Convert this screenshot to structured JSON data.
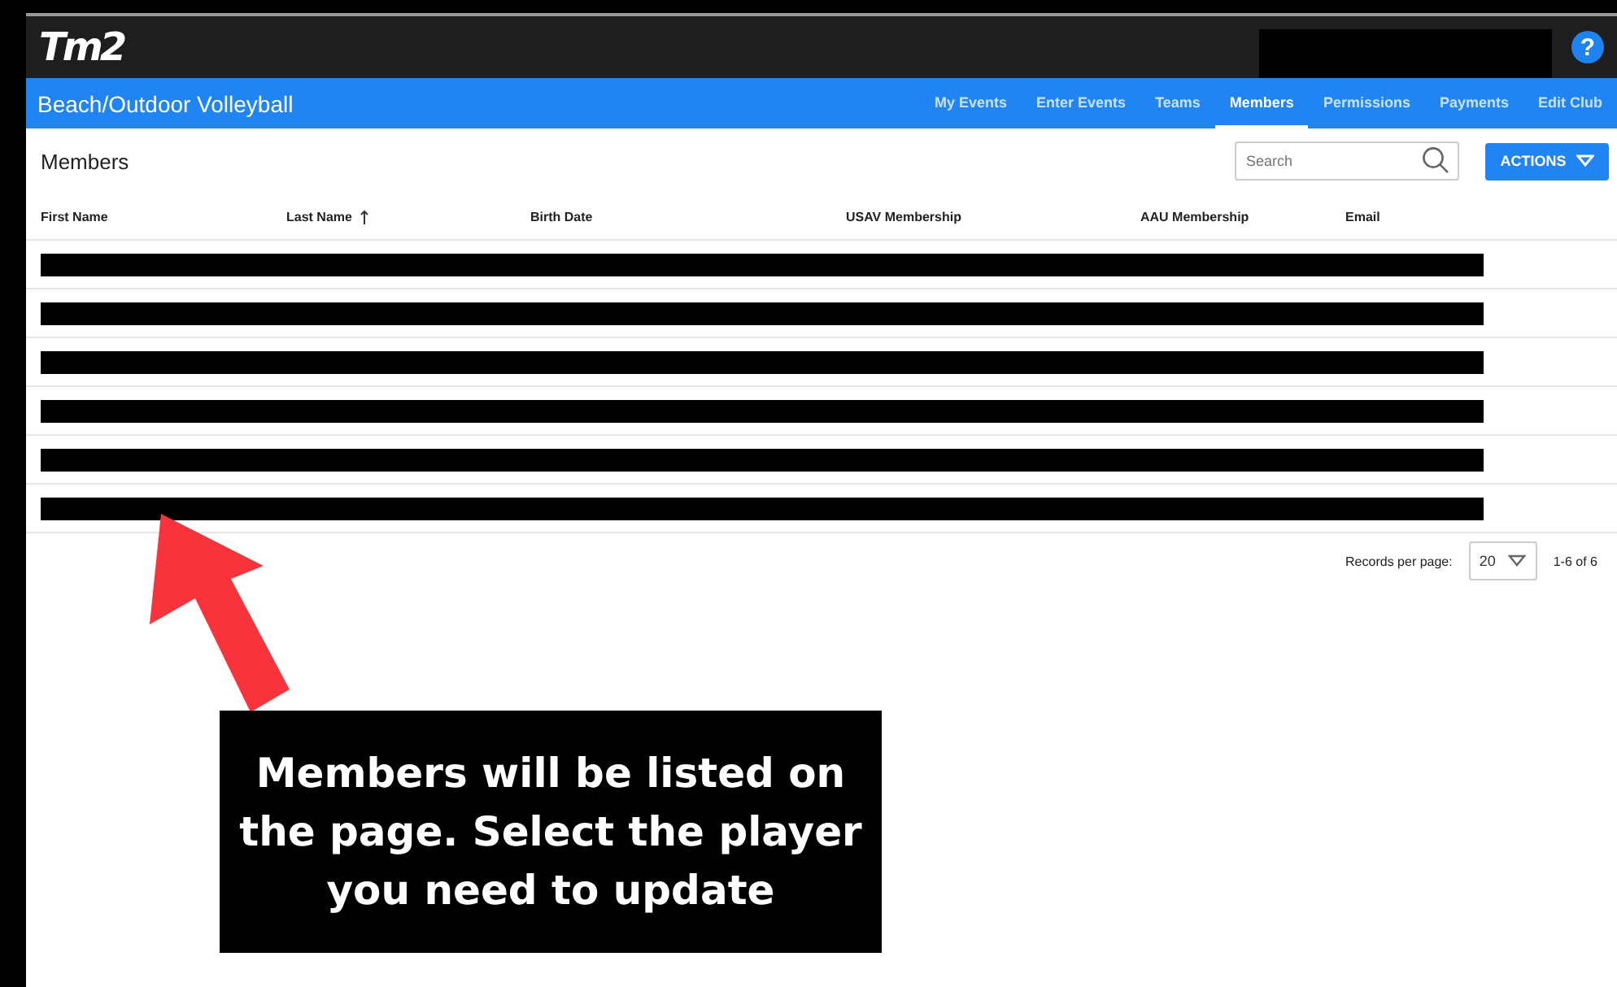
{
  "header": {
    "logo": "Tm2",
    "help": "?"
  },
  "nav": {
    "title": "Beach/Outdoor Volleyball",
    "tabs": [
      {
        "label": "My Events",
        "selected": false
      },
      {
        "label": "Enter Events",
        "selected": false
      },
      {
        "label": "Teams",
        "selected": false
      },
      {
        "label": "Members",
        "selected": true
      },
      {
        "label": "Permissions",
        "selected": false
      },
      {
        "label": "Payments",
        "selected": false
      },
      {
        "label": "Edit Club",
        "selected": false
      }
    ]
  },
  "page": {
    "title": "Members",
    "search": {
      "placeholder": "Search"
    },
    "actions": "ACTIONS"
  },
  "table": {
    "columns": [
      {
        "label": "First Name",
        "sorted": false
      },
      {
        "label": "Last Name",
        "sorted": true
      },
      {
        "label": "Birth Date",
        "sorted": false
      },
      {
        "label": "USAV Membership",
        "sorted": false
      },
      {
        "label": "AAU Membership",
        "sorted": false
      },
      {
        "label": "Email",
        "sorted": false
      }
    ],
    "rows": [
      {
        "redacted": true
      },
      {
        "redacted": true
      },
      {
        "redacted": true
      },
      {
        "redacted": true
      },
      {
        "redacted": true
      },
      {
        "redacted": true
      }
    ]
  },
  "pagination": {
    "label": "Records per page:",
    "per_page": "20",
    "range": "1-6 of 6"
  },
  "callout": {
    "text": "Members will be listed on the page. Select the player you need to update"
  }
}
